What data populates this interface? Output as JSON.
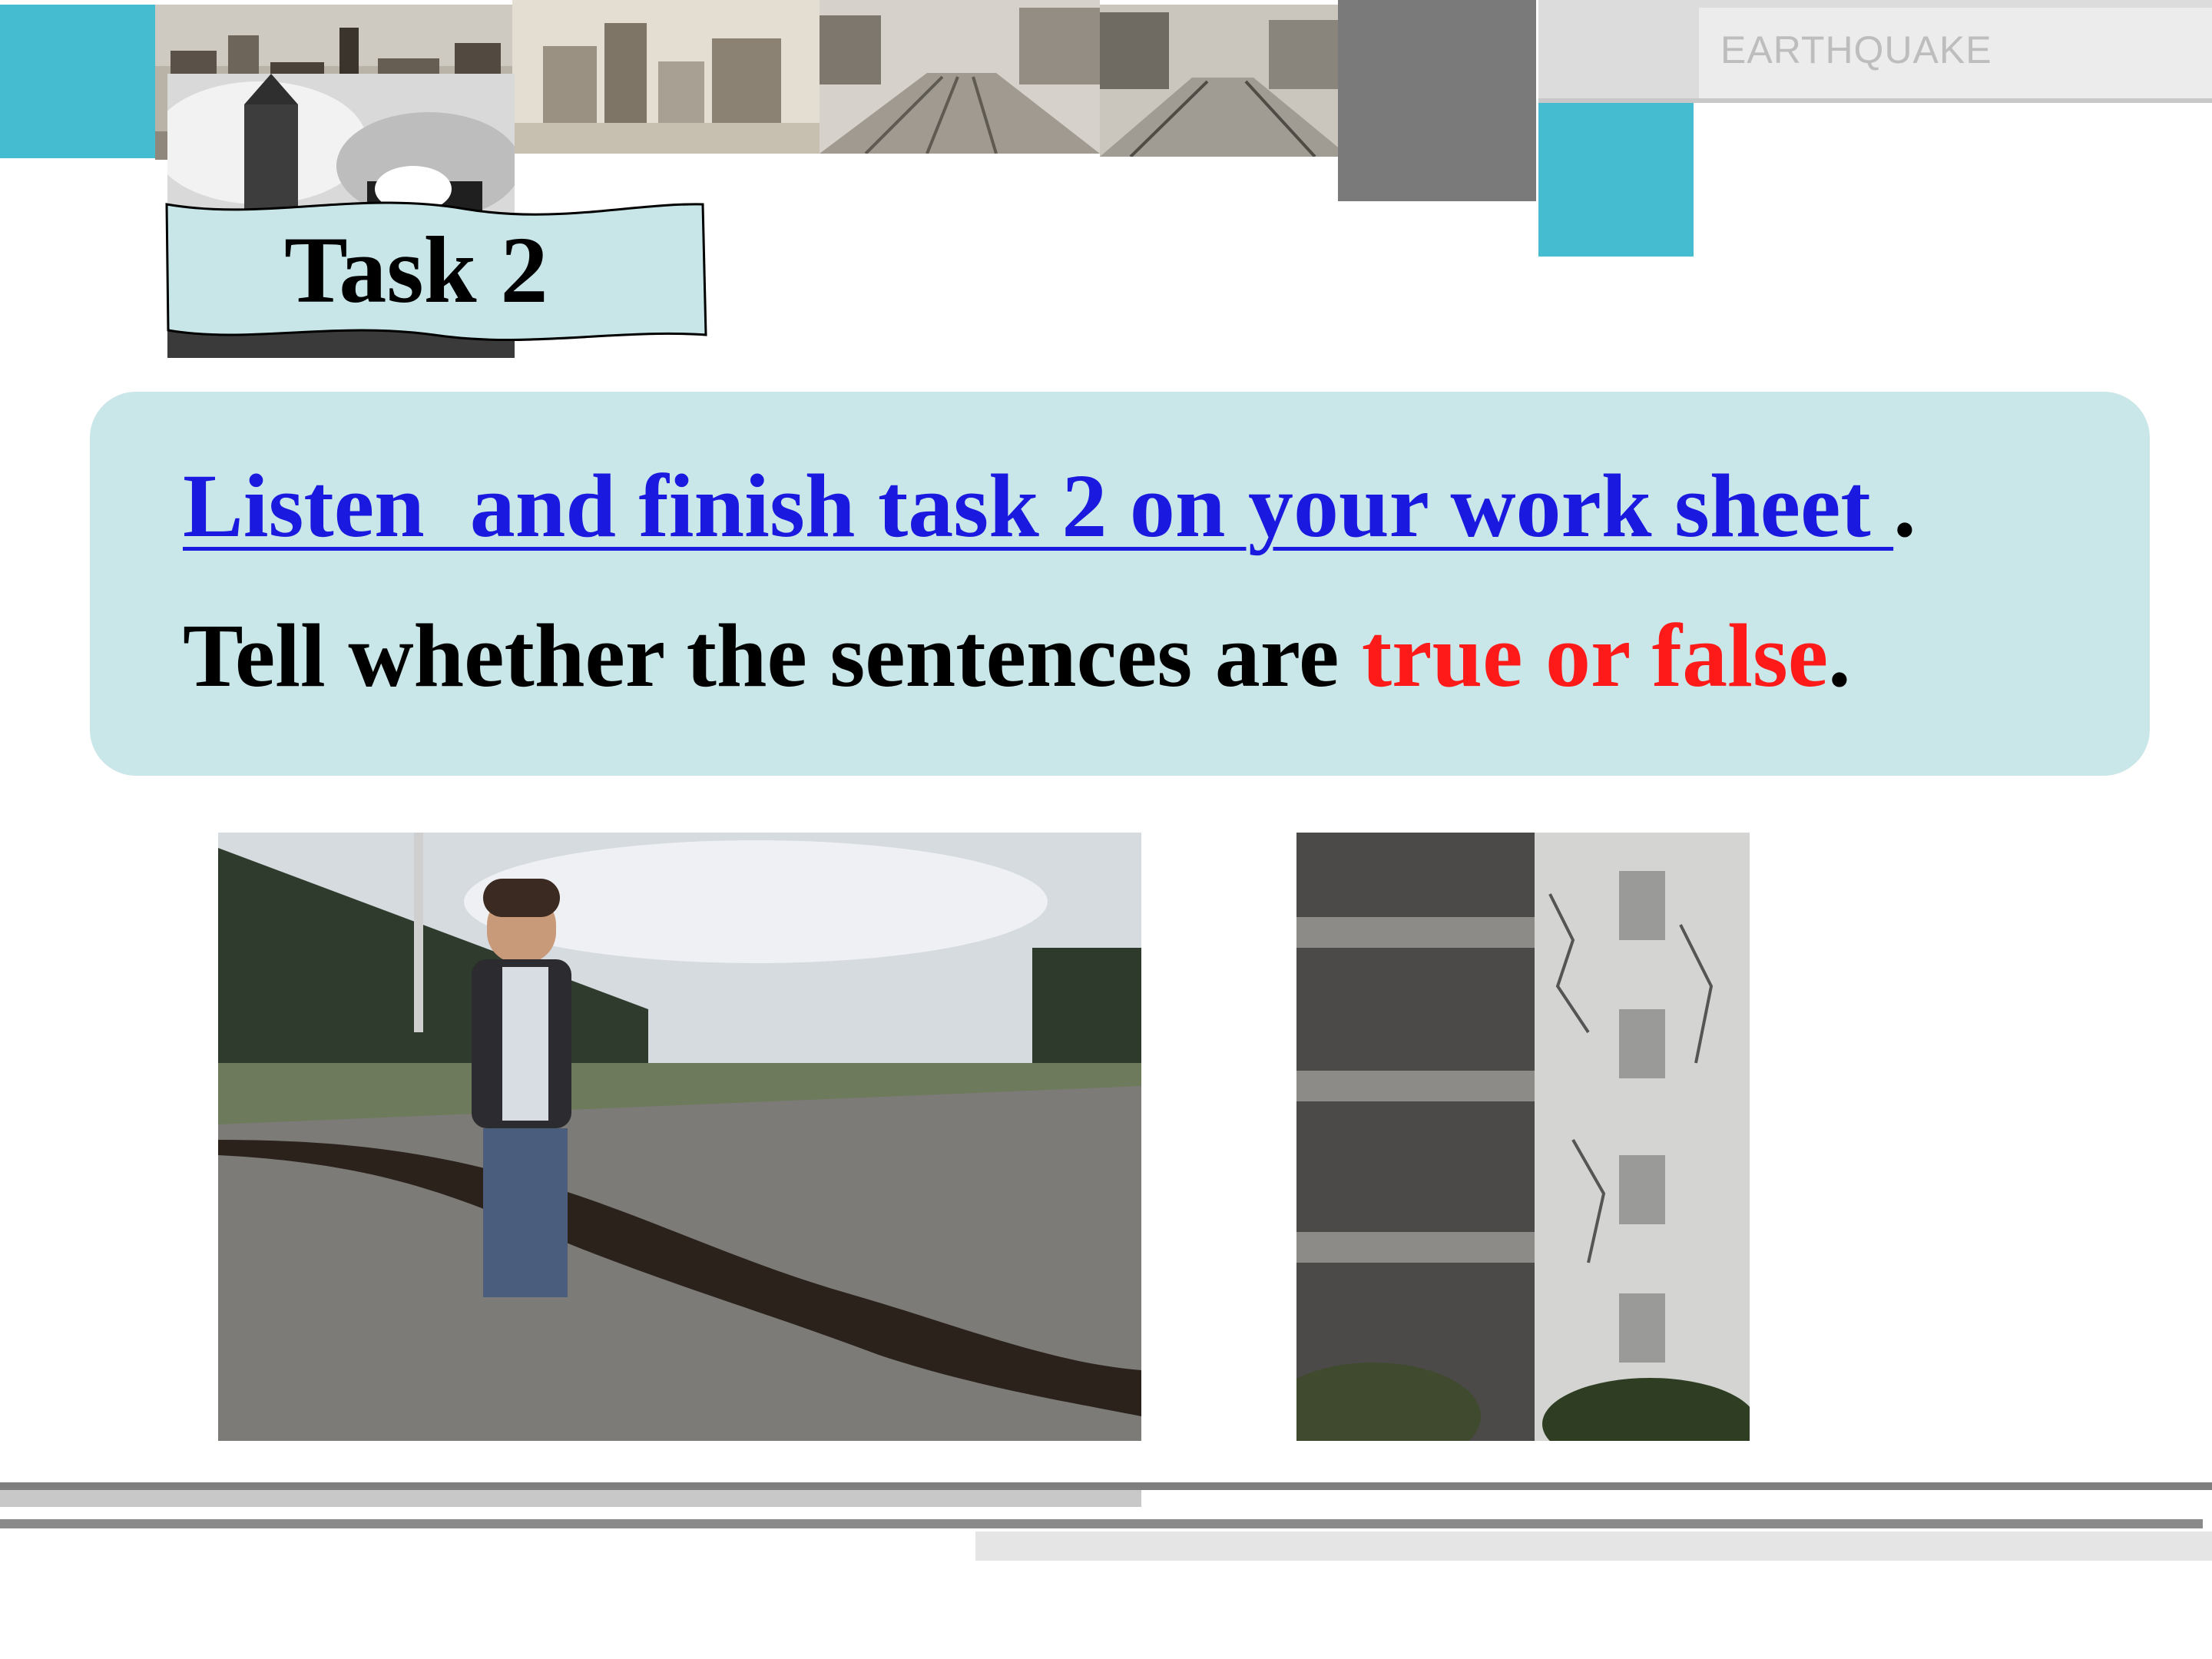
{
  "header": {
    "topic_label": "EARTHQUAKE"
  },
  "banner": {
    "title": "Task 2"
  },
  "instructions": {
    "line1_link": "Listen  and finish task 2 on your work sheet ",
    "line1_end": ".",
    "line2_start": "Tell whether the sentences are ",
    "line2_highlight": "true or false",
    "line2_end": "."
  },
  "colors": {
    "accent_teal": "#45bccf",
    "panel_bg": "#c9e6e8",
    "link_blue": "#1a19e0",
    "highlight_red": "#ff1a1a"
  },
  "images": {
    "top_strip": [
      "fire-icon",
      "ruined-city-icon",
      "ruined-buildings-icon",
      "broken-street-icon"
    ],
    "bottom": [
      "road-crack-boy-photo",
      "collapsed-building-photo"
    ]
  }
}
